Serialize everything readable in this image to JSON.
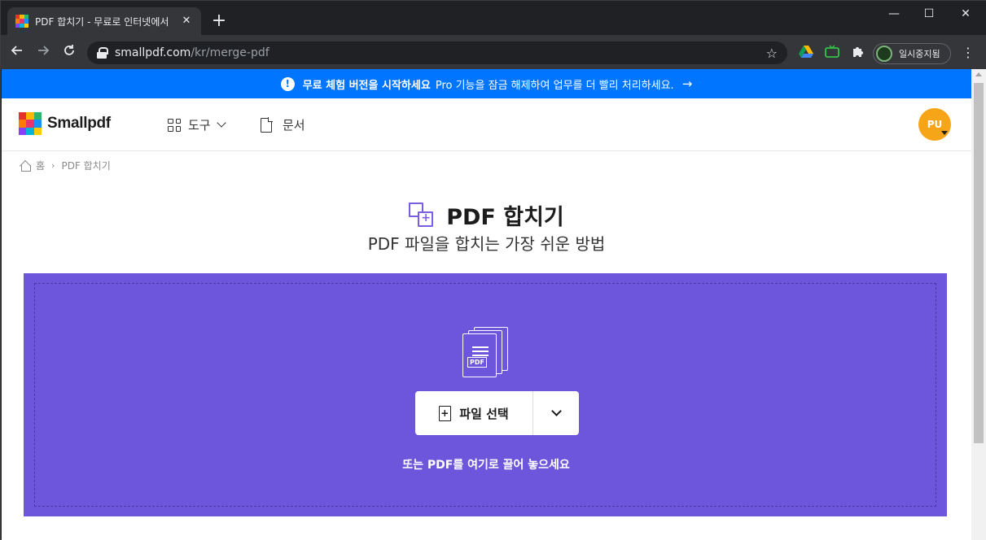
{
  "browser": {
    "tab_title": "PDF 합치기 - 무료로 인터넷에서",
    "tab_close": "✕",
    "new_tab": "+",
    "window_controls": {
      "minimize": "—",
      "maximize": "☐",
      "close": "✕"
    },
    "url_host": "smallpdf.com",
    "url_path": "/kr/merge-pdf",
    "profile_label": "일시중지됨"
  },
  "promo": {
    "title": "무료 체험 버전을 시작하세요",
    "text": "Pro 기능을 잠금 해제하여 업무를 더 빨리 처리하세요.",
    "arrow": "→",
    "alert_glyph": "!"
  },
  "header": {
    "brand": "Smallpdf",
    "tools_label": "도구",
    "docs_label": "문서",
    "avatar_initials": "PU"
  },
  "breadcrumb": {
    "home": "홈",
    "separator": "›",
    "current": "PDF 합치기"
  },
  "hero": {
    "title": "PDF 합치기",
    "subtitle": "PDF 파일을 합치는 가장 쉬운 방법"
  },
  "dropzone": {
    "file_tag": "PDF",
    "choose_label": "파일 선택",
    "hint": "또는 PDF를 여기로 끌어 놓으세요"
  },
  "colors": {
    "promo_bg": "#0075ff",
    "dropzone_bg": "#6d56db",
    "avatar_bg": "#f6a519",
    "accent": "#7b5fe0"
  }
}
